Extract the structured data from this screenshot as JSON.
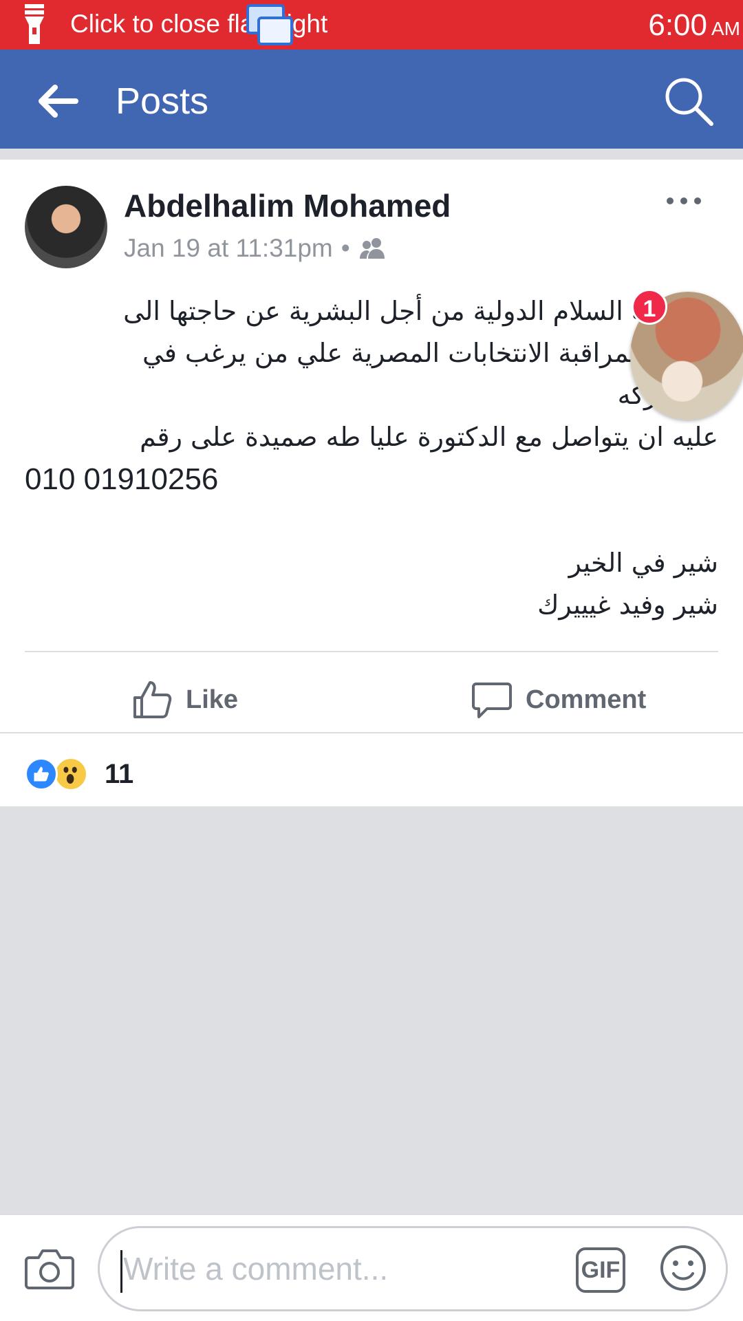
{
  "status_bar": {
    "notification_text": "Click to close flashlight",
    "time": "6:00",
    "ampm": "AM"
  },
  "app_bar": {
    "title": "Posts"
  },
  "post": {
    "author": "Abdelhalim Mohamed",
    "timestamp": "Jan 19 at 11:31pm",
    "separator": "•",
    "audience_icon": "friends-icon",
    "text_lines": [
      "مؤسسة السلام الدولية من أجل البشرية عن حاجتها الى",
      "متطوع لمراقبة الانتخابات المصرية علي من يرغب في",
      "المشاركه",
      "عليه ان يتواصل مع الدكتورة عليا طه صميدة على رقم",
      "010 01910256",
      "",
      "شير في الخير",
      "شير وفيد غيييرك"
    ],
    "like_label": "Like",
    "comment_label": "Comment",
    "reaction_count": "11",
    "reactions": [
      "like-reaction-icon",
      "wow-reaction-icon"
    ]
  },
  "chat_head": {
    "badge": "1"
  },
  "comment_bar": {
    "placeholder": "Write a comment...",
    "gif_label": "GIF"
  },
  "colors": {
    "status_bar": "#e02a2f",
    "app_bar": "#4267b2",
    "like_blue": "#2d88ff",
    "badge_red": "#f02849"
  }
}
